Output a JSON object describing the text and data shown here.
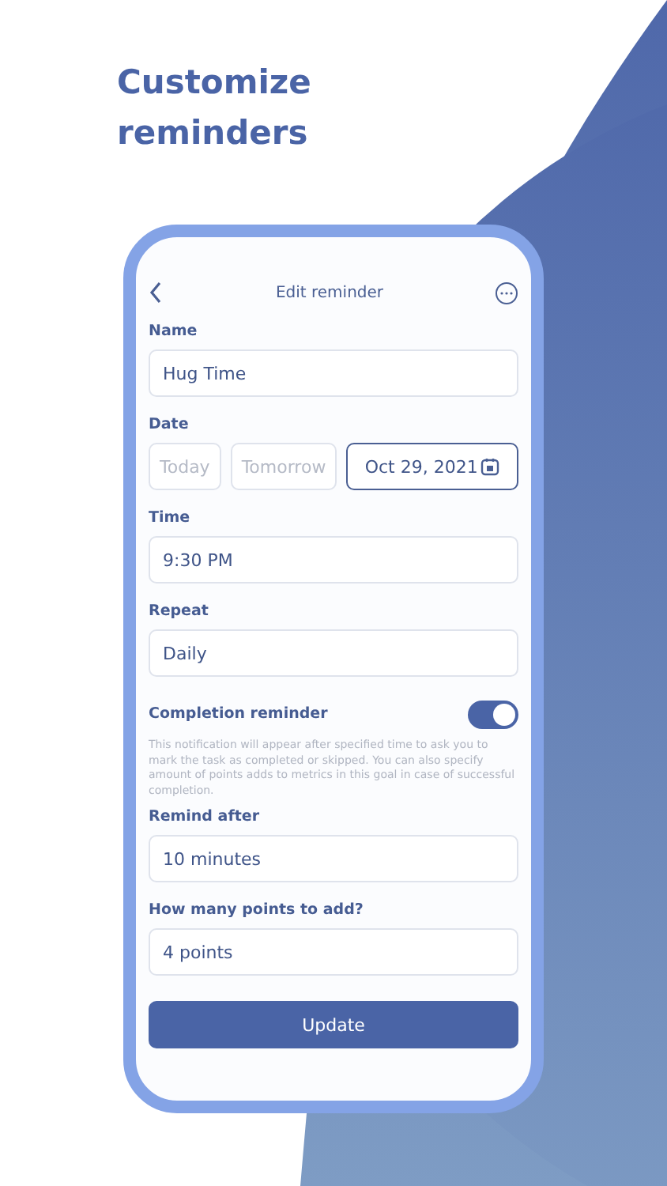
{
  "headline": "Customize reminders",
  "screen": {
    "title": "Edit reminder"
  },
  "fields": [
    {
      "kind": "text",
      "label": "Name",
      "value": "Hug Time"
    },
    {
      "kind": "date",
      "label": "Date",
      "options": [
        {
          "label": "Today",
          "selected": false
        },
        {
          "label": "Tomorrow",
          "selected": false
        },
        {
          "label": "Oct 29, 2021",
          "selected": true
        }
      ]
    },
    {
      "kind": "text",
      "label": "Time",
      "value": "9:30 PM"
    },
    {
      "kind": "text",
      "label": "Repeat",
      "value": "Daily"
    },
    {
      "kind": "toggle",
      "label": "Completion reminder",
      "on": true,
      "note": "This notification will appear after specified time to ask you to mark the task as completed or skipped. You can also specify amount of points adds to metrics in this goal in case of successful completion."
    },
    {
      "kind": "text",
      "label": "Remind after",
      "value": "10 minutes"
    },
    {
      "kind": "text",
      "label": "How many points to add?",
      "value": "4 points"
    }
  ],
  "button": "Update"
}
